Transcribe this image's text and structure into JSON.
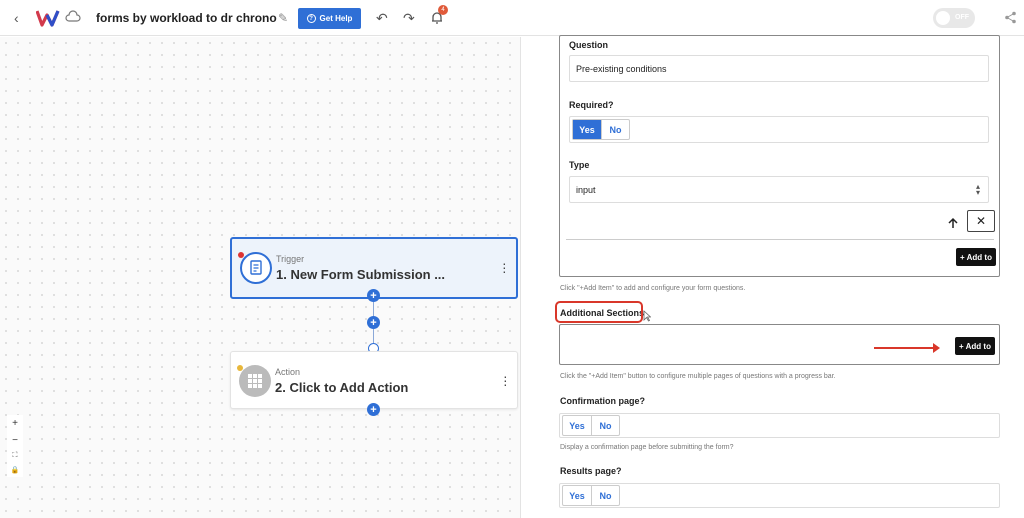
{
  "topbar": {
    "title": "forms by workload to dr chrono",
    "help_label": "Get Help",
    "notification_count": "4",
    "toggle_label": "OFF",
    "accent_color": "#2f6fd6"
  },
  "canvas": {
    "zoom_controls": [
      "+",
      "−",
      "⛶",
      "🔒"
    ],
    "trigger": {
      "kind": "Trigger",
      "title": "1. New Form Submission ..."
    },
    "action": {
      "kind": "Action",
      "title": "2. Click to Add Action"
    }
  },
  "panel": {
    "question_label": "Question",
    "question_value": "Pre-existing conditions",
    "required_label": "Required?",
    "required_options": [
      "Yes",
      "No"
    ],
    "type_label": "Type",
    "type_value": "input",
    "add_label": "+ Add to",
    "items_help": "Click \"+Add Item\" to add and configure your form questions.",
    "sections_label": "Additional Sections",
    "sections_add_label": "+ Add to",
    "sections_help": "Click the \"+Add Item\" button to configure multiple pages of questions with a progress bar.",
    "confirmation_label": "Confirmation page?",
    "confirmation_options": [
      "Yes",
      "No"
    ],
    "confirmation_help": "Display a confirmation page before submitting the form?",
    "results_label": "Results page?",
    "results_options": [
      "Yes",
      "No"
    ]
  }
}
